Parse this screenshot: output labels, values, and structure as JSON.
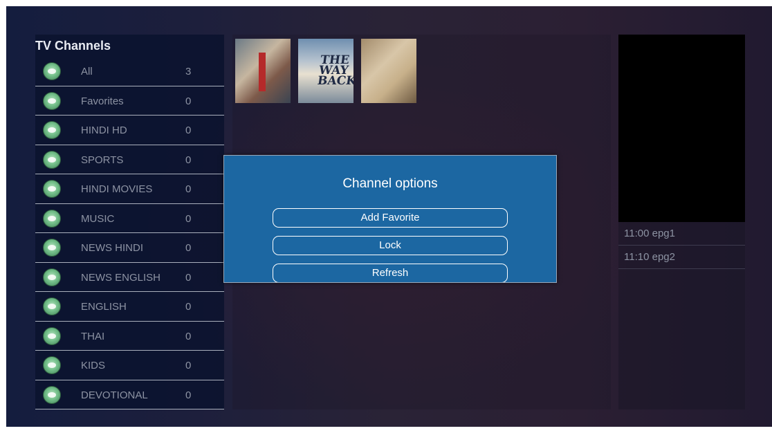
{
  "sidebar": {
    "title": "TV Channels",
    "channels": [
      {
        "name": "All",
        "count": "3"
      },
      {
        "name": "Favorites",
        "count": "0"
      },
      {
        "name": "HINDI HD",
        "count": "0"
      },
      {
        "name": "SPORTS",
        "count": "0"
      },
      {
        "name": "HINDI MOVIES",
        "count": "0"
      },
      {
        "name": "MUSIC",
        "count": "0"
      },
      {
        "name": "NEWS HINDI",
        "count": "0"
      },
      {
        "name": "NEWS ENGLISH",
        "count": "0"
      },
      {
        "name": "ENGLISH",
        "count": "0"
      },
      {
        "name": "THAI",
        "count": "0"
      },
      {
        "name": "KIDS",
        "count": "0"
      },
      {
        "name": "DEVOTIONAL",
        "count": "0"
      }
    ]
  },
  "posters": [
    {
      "text": ""
    },
    {
      "text": "THE WAY BACK"
    },
    {
      "text": ""
    }
  ],
  "epg": [
    {
      "time": "11:00",
      "title": "epg1"
    },
    {
      "time": "11:10",
      "title": "epg2"
    }
  ],
  "dialog": {
    "title": "Channel options",
    "buttons": {
      "add_favorite": "Add Favorite",
      "lock": "Lock",
      "refresh": "Refresh"
    }
  },
  "colors": {
    "dialog_bg": "#1c67a2",
    "panel_bg": "#0a122d",
    "text_muted": "#8d93a3"
  }
}
